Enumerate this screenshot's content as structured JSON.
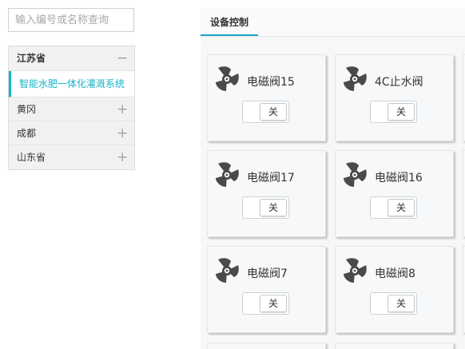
{
  "search": {
    "placeholder": "输入编号或名称查询"
  },
  "tree": {
    "province_1": {
      "label": "江苏省",
      "sign": "−"
    },
    "selected_item": {
      "label": "智能水肥一体化灌溉系统"
    },
    "items": [
      {
        "label": "黄冈",
        "sign": "+"
      },
      {
        "label": "成都",
        "sign": "+"
      },
      {
        "label": "山东省",
        "sign": "+"
      }
    ]
  },
  "tabs": [
    {
      "label": "设备控制",
      "active": true
    }
  ],
  "devices": [
    {
      "name": "电磁阀15",
      "state": "关",
      "icon": "fan-icon"
    },
    {
      "name": "4C止水阀",
      "state": "关",
      "icon": "fan-icon"
    },
    {
      "name": "电磁阀17",
      "state": "关",
      "icon": "fan-icon"
    },
    {
      "name": "电磁阀16",
      "state": "关",
      "icon": "fan-icon"
    },
    {
      "name": "电磁阀7",
      "state": "关",
      "icon": "fan-icon"
    },
    {
      "name": "电磁阀8",
      "state": "关",
      "icon": "fan-icon"
    }
  ],
  "colors": {
    "accent": "#17b3c8",
    "icon": "#4a4a4a"
  }
}
